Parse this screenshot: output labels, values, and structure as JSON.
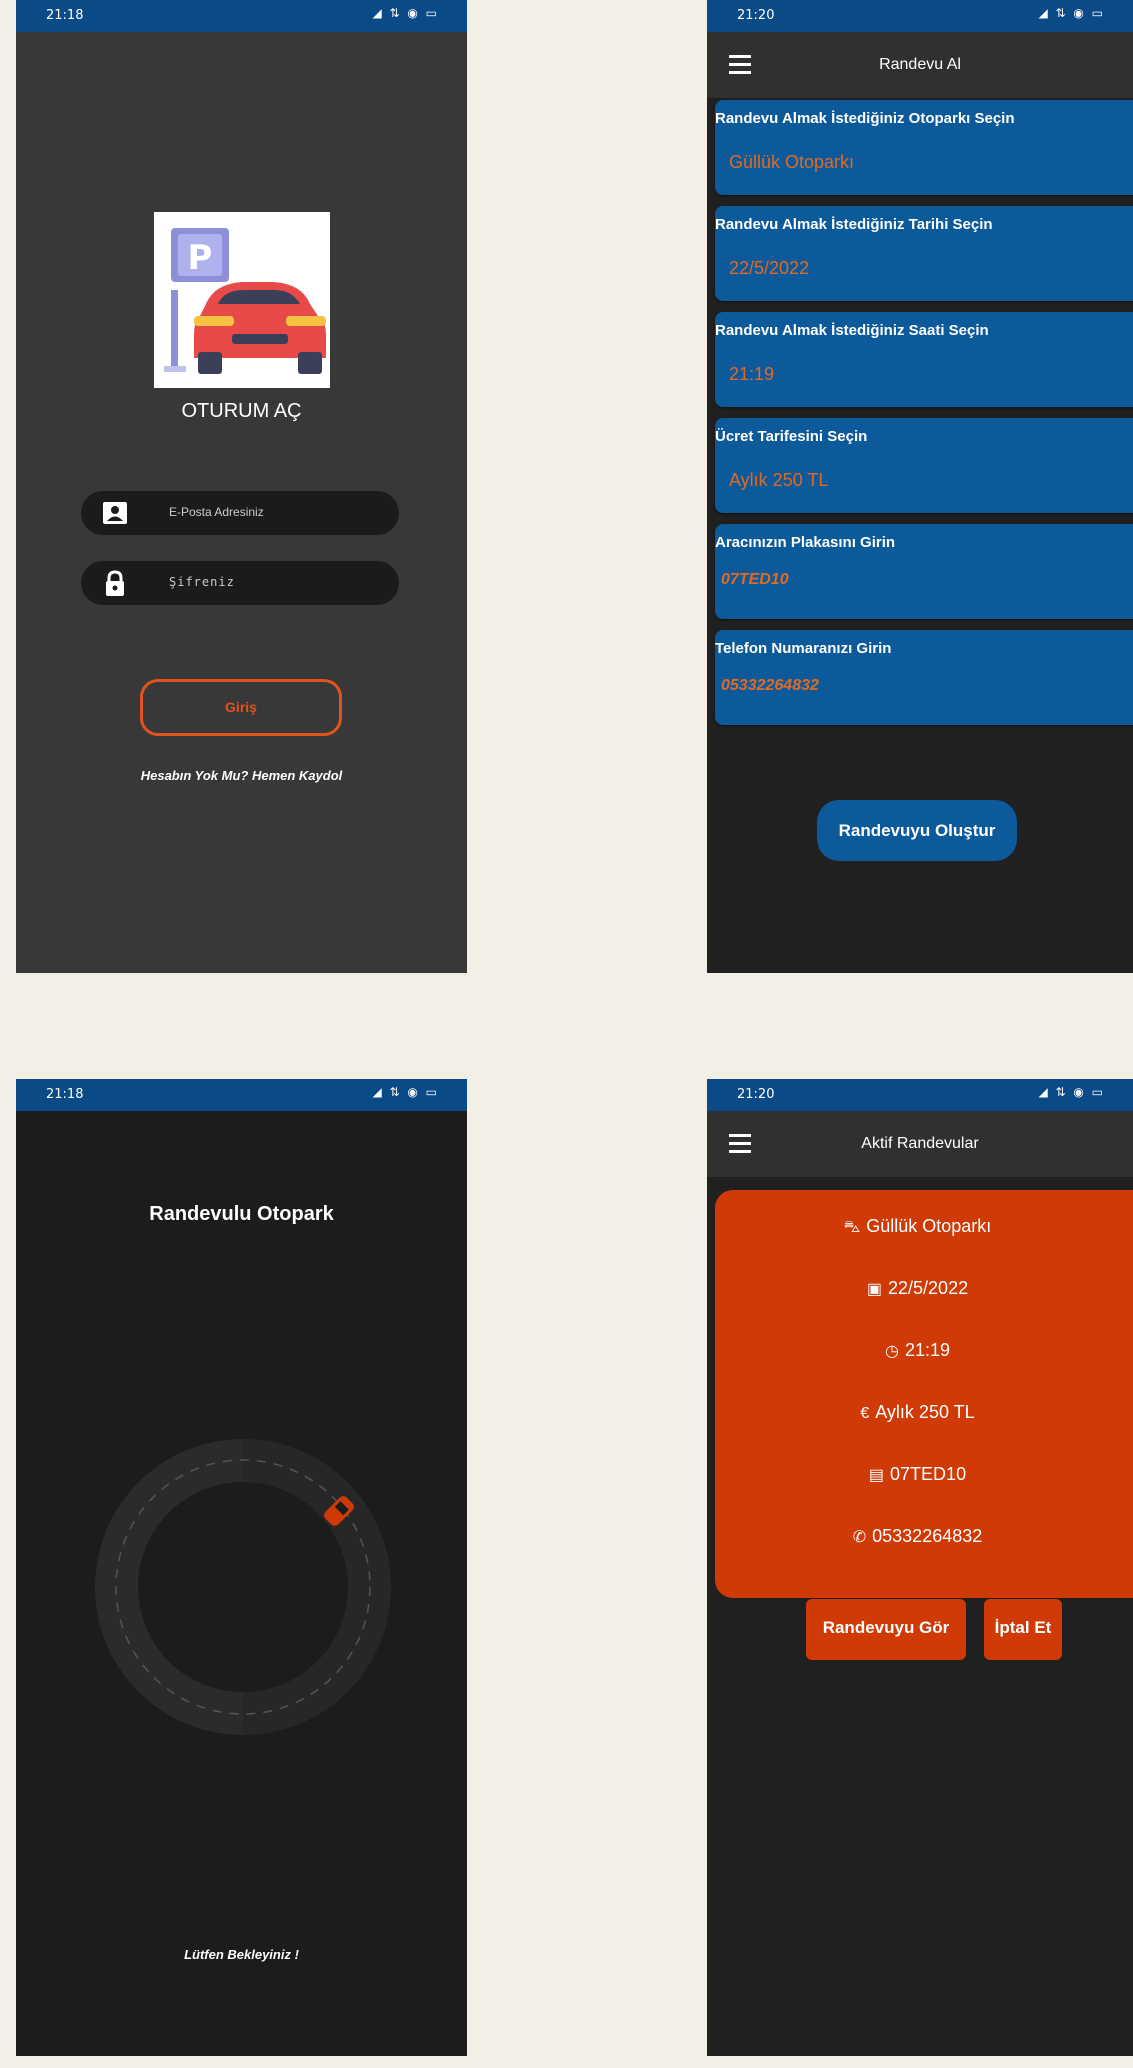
{
  "status_bar": {
    "screen1_time": "21:18",
    "screen2_time": "21:20",
    "screen3_time": "21:18",
    "screen4_time": "21:20"
  },
  "login": {
    "title": "OTURUM AÇ",
    "email_placeholder": "E-Posta Adresiniz",
    "password_placeholder": "Şifreniz",
    "submit_label": "Giriş",
    "register_link": "Hesabın Yok Mu? Hemen Kaydol"
  },
  "appointment_form": {
    "header_title": "Randevu Al",
    "fields": [
      {
        "label": "Randevu Almak İstediğiniz Otoparkı Seçin",
        "value": "Güllük Otoparkı"
      },
      {
        "label": "Randevu Almak İstediğiniz Tarihi Seçin",
        "value": "22/5/2022"
      },
      {
        "label": "Randevu Almak İstediğiniz Saati Seçin",
        "value": "21:19"
      },
      {
        "label": "Ücret Tarifesini Seçin",
        "value": "Aylık 250 TL"
      },
      {
        "label": "Aracınızın Plakasını Girin",
        "value": "07TED10"
      },
      {
        "label": "Telefon Numaranızı Girin",
        "value": "05332264832"
      }
    ],
    "submit_label": "Randevuyu Oluştur"
  },
  "loading": {
    "title": "Randevulu Otopark",
    "message": "Lütfen Bekleyiniz !"
  },
  "active_appointments": {
    "header_title": "Aktif Randevular",
    "card": {
      "parking": "Güllük Otoparkı",
      "date": "22/5/2022",
      "time": "21:19",
      "tariff": "Aylık 250 TL",
      "plate": "07TED10",
      "phone": "05332264832"
    },
    "view_label": "Randevuyu Gör",
    "cancel_label": "İptal Et"
  },
  "colors": {
    "status_bar": "#0a4a86",
    "form_card": "#0d5a9b",
    "accent_orange": "#e0531c",
    "active_card": "#d03a06"
  }
}
